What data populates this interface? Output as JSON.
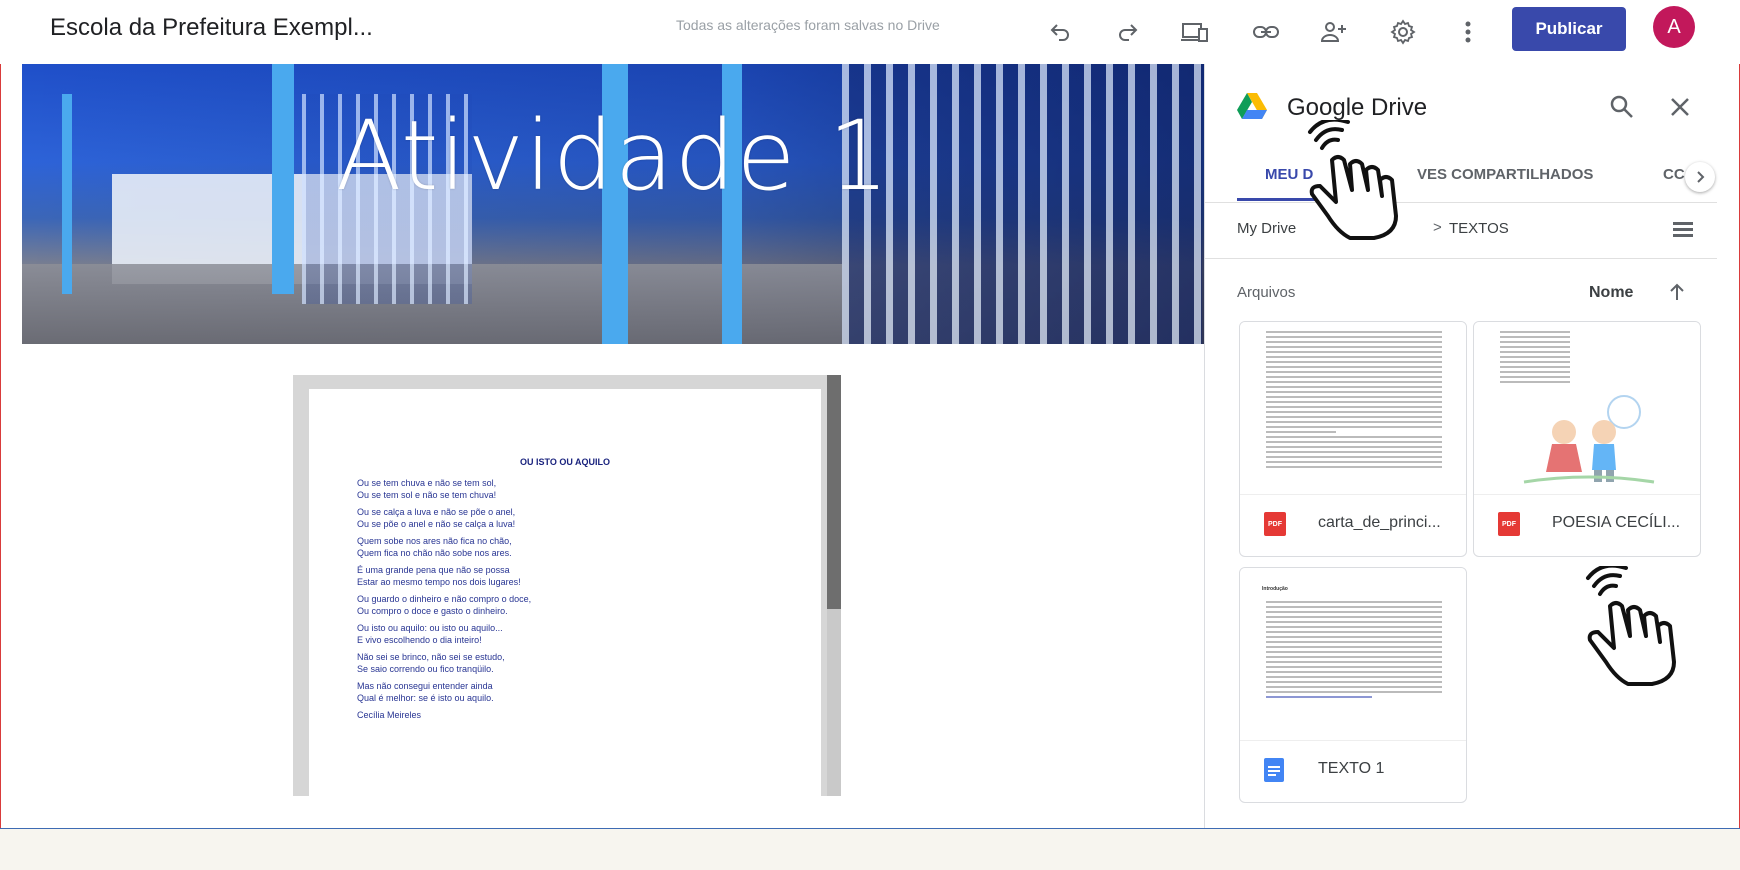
{
  "topbar": {
    "site_title": "Escola da Prefeitura Exempl...",
    "save_status": "Todas as alterações foram salvas no Drive",
    "publish_label": "Publicar",
    "avatar_letter": "A",
    "icons": [
      "undo-icon",
      "redo-icon",
      "preview-device-icon",
      "link-icon",
      "share-person-add-icon",
      "settings-icon",
      "more-vert-icon"
    ]
  },
  "banner": {
    "title": "Atividade 1"
  },
  "embedded_doc": {
    "title": "OU ISTO OU AQUILO",
    "stanzas": [
      "Ou se tem chuva e não se tem sol,\nOu se tem sol e não se tem chuva!",
      "Ou se calça a luva e não se põe o anel,\nOu se põe o anel e não se calça a luva!",
      "Quem sobe nos ares não fica no chão,\nQuem fica no chão não sobe nos ares.",
      "É uma grande pena que não se possa\nEstar ao mesmo tempo nos dois lugares!",
      "Ou guardo o dinheiro e não compro o doce,\nOu compro o doce e gasto o dinheiro.",
      "Ou isto ou aquilo: ou isto ou aquilo...\nE vivo escolhendo o dia inteiro!",
      "Não sei se brinco, não sei se estudo,\nSe saio correndo ou fico tranqüilo.",
      "Mas não consegui entender ainda\n Qual é melhor: se é isto ou aquilo.",
      "Cecília Meireles"
    ]
  },
  "drive": {
    "title": "Google Drive",
    "tabs": [
      "MEU D",
      "VES COMPARTILHADOS",
      "CC"
    ],
    "breadcrumb": {
      "root": "My Drive",
      "separator": ">",
      "current": "TEXTOS"
    },
    "files_header": "Arquivos",
    "sort_label": "Nome",
    "files": [
      {
        "name": "carta_de_princi...",
        "type": "PDF"
      },
      {
        "name": "POESIA CECÍLI...",
        "type": "PDF"
      },
      {
        "name": "TEXTO 1",
        "type": "doc"
      }
    ],
    "doc_preview_heading": "Introdução"
  },
  "colors": {
    "accent": "#3949ab",
    "avatar": "#c2185b",
    "pdf": "#e53935",
    "doc": "#4285f4"
  }
}
